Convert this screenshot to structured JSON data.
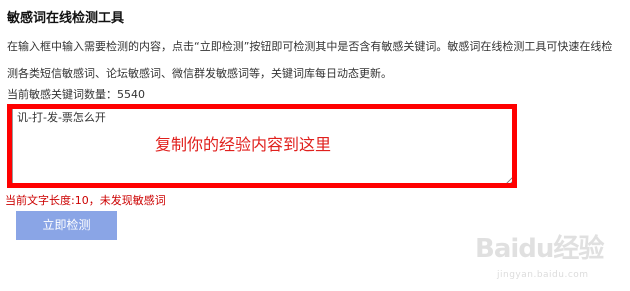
{
  "title": "敏感词在线检测工具",
  "description": "在输入框中输入需要检测的内容，点击“立即检测”按钮即可检测其中是否含有敏感关键词。敏感词在线检测工具可快速在线检测各类短信敏感词、论坛敏感词、微信群发敏感词等，关键词库每日动态更新。",
  "keyword_count": "当前敏感关键词数量：5540",
  "input": {
    "value": "讥-打-发-票怎么开"
  },
  "annotation": "复制你的经验内容到这里",
  "status": "当前文字长度:10，未发现敏感词",
  "check_button": "立即检测",
  "watermark": {
    "logo": "Baidu经验",
    "site": "jingyan.baidu.com"
  },
  "colors": {
    "highlight": "#ff0000",
    "annotation": "#e0201d",
    "status": "#cc0000",
    "button": "#8aa5e6"
  }
}
